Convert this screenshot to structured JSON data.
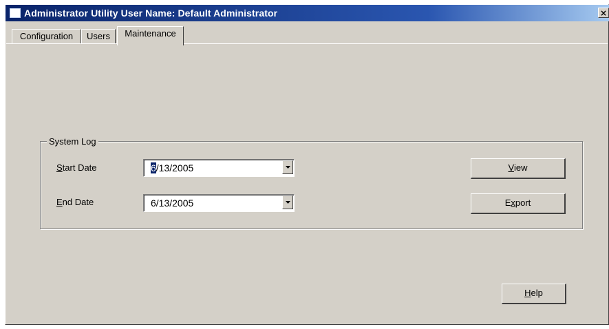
{
  "window": {
    "title": "Administrator Utility  User Name: Default Administrator",
    "close_glyph": "×"
  },
  "tabs": [
    {
      "label": "Configuration",
      "active": false
    },
    {
      "label": "Users",
      "active": false
    },
    {
      "label": "Maintenance",
      "active": true
    }
  ],
  "system_log": {
    "title": "System Log",
    "start_date": {
      "label_mnemonic": "S",
      "label_rest": "tart Date",
      "value_selected": "6",
      "value_rest": "/13/2005"
    },
    "end_date": {
      "label_mnemonic": "E",
      "label_rest": "nd Date",
      "value": "6/13/2005"
    },
    "view_button": {
      "mnemonic": "V",
      "rest": "iew"
    },
    "export_button": {
      "pre": "E",
      "mnemonic": "x",
      "rest": "port"
    }
  },
  "help_button": {
    "mnemonic": "H",
    "rest": "elp"
  },
  "icons": {
    "app": "window-icon",
    "close": "close-icon",
    "dropdown": "chevron-down-icon"
  }
}
